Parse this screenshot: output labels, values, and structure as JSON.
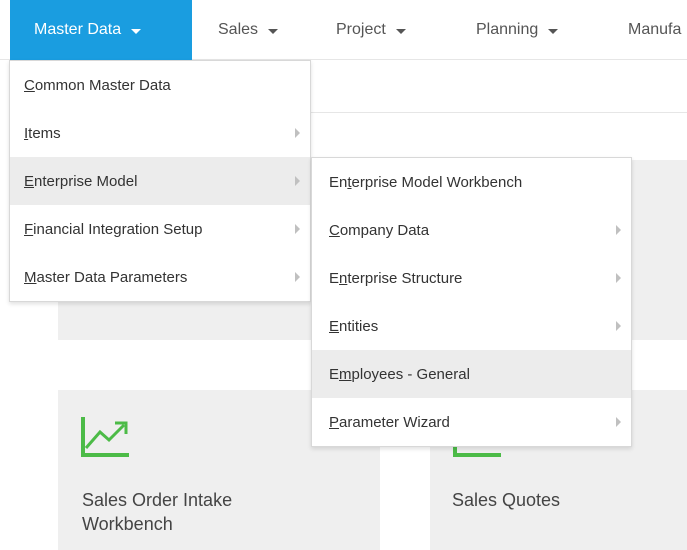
{
  "nav": {
    "items": [
      {
        "label": "Master Data",
        "active": true
      },
      {
        "label": "Sales"
      },
      {
        "label": "Project"
      },
      {
        "label": "Planning"
      },
      {
        "label": "Manufa"
      }
    ]
  },
  "menu1": {
    "items": [
      {
        "u": "C",
        "rest": "ommon Master Data",
        "submenu": false
      },
      {
        "u": "I",
        "rest": "tems",
        "submenu": true
      },
      {
        "u": "E",
        "rest": "nterprise Model",
        "submenu": true,
        "highlighted": true
      },
      {
        "u": "F",
        "rest": "inancial Integration Setup",
        "submenu": true
      },
      {
        "u": "M",
        "rest": "aster Data Parameters",
        "submenu": true
      }
    ]
  },
  "menu2": {
    "items": [
      {
        "pre": "En",
        "u": "t",
        "rest": "erprise Model Workbench",
        "submenu": false
      },
      {
        "pre": "",
        "u": "C",
        "rest": "ompany Data",
        "submenu": true
      },
      {
        "pre": "E",
        "u": "n",
        "rest": "terprise Structure",
        "submenu": true
      },
      {
        "pre": "",
        "u": "E",
        "rest": "ntities",
        "submenu": true
      },
      {
        "pre": "E",
        "u": "m",
        "rest": "ployees - General",
        "submenu": false,
        "highlighted": true
      },
      {
        "pre": "",
        "u": "P",
        "rest": "arameter Wizard",
        "submenu": true
      }
    ]
  },
  "tiles": {
    "sales_order_intake": {
      "line1": "Sales Order Intake",
      "line2": "Workbench",
      "icon": "trend-up-icon"
    },
    "sales_quotes": {
      "label": "Sales Quotes",
      "icon": "chart-icon"
    }
  },
  "colors": {
    "accent": "#1a9de0",
    "icon_green": "#4cbb47"
  }
}
